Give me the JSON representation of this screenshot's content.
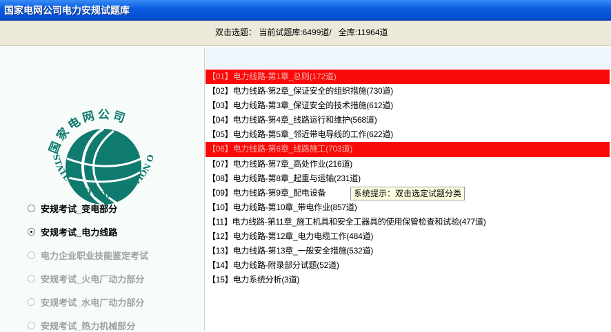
{
  "window": {
    "title": "国家电网公司电力安规试题库"
  },
  "toolbar": {
    "stats": "双击选题： 当前试题库:6499道/   全库:11964道"
  },
  "logo": {
    "cn": "国家电网公司",
    "en": "STATE GRID CORPORATION OF CHINA",
    "color": "#0f7a6e"
  },
  "categories": [
    {
      "label": "安规考试_变电部分",
      "checked": false,
      "enabled": true
    },
    {
      "label": "安规考试_电力线路",
      "checked": true,
      "enabled": true
    },
    {
      "label": "电力企业职业技能鉴定考试",
      "checked": false,
      "enabled": false
    },
    {
      "label": "安规考试_火电厂动力部分",
      "checked": false,
      "enabled": false
    },
    {
      "label": "安规考试_水电厂动力部分",
      "checked": false,
      "enabled": false
    },
    {
      "label": "安规考试_热力机械部分",
      "checked": false,
      "enabled": false
    }
  ],
  "chapters": [
    {
      "label": "【01】电力线路-第1章_总则(172道)",
      "selected": true
    },
    {
      "label": "【02】电力线路-第2章_保证安全的组织措施(730道)",
      "selected": false
    },
    {
      "label": "【03】电力线路-第3章_保证安全的技术措施(612道)",
      "selected": false
    },
    {
      "label": "【04】电力线路-第4章_线路运行和维护(568道)",
      "selected": false
    },
    {
      "label": "【05】电力线路-第5章_邻近带电导线的工作(622道)",
      "selected": false
    },
    {
      "label": "【06】电力线路-第6章_线路施工(703道)",
      "selected": true
    },
    {
      "label": "【07】电力线路-第7章_高处作业(216道)",
      "selected": false
    },
    {
      "label": "【08】电力线路-第8章_起重与运输(231道)",
      "selected": false
    },
    {
      "label": "【09】电力线路-第9章_配电设备",
      "selected": false
    },
    {
      "label": "【10】电力线路-第10章_带电作业(857道)",
      "selected": false
    },
    {
      "label": "【11】电力线路-第11章_施工机具和安全工器具的使用保管检查和试验(477道)",
      "selected": false
    },
    {
      "label": "【12】电力线路-第12章_电力电缆工作(484道)",
      "selected": false
    },
    {
      "label": "【13】电力线路-第13章_一般安全措施(532道)",
      "selected": false
    },
    {
      "label": "【14】电力线路-附录部分试题(52道)",
      "selected": false
    },
    {
      "label": "【15】电力系统分析(3道)",
      "selected": false
    }
  ],
  "tooltip": "系统提示：双击选定试题分类"
}
